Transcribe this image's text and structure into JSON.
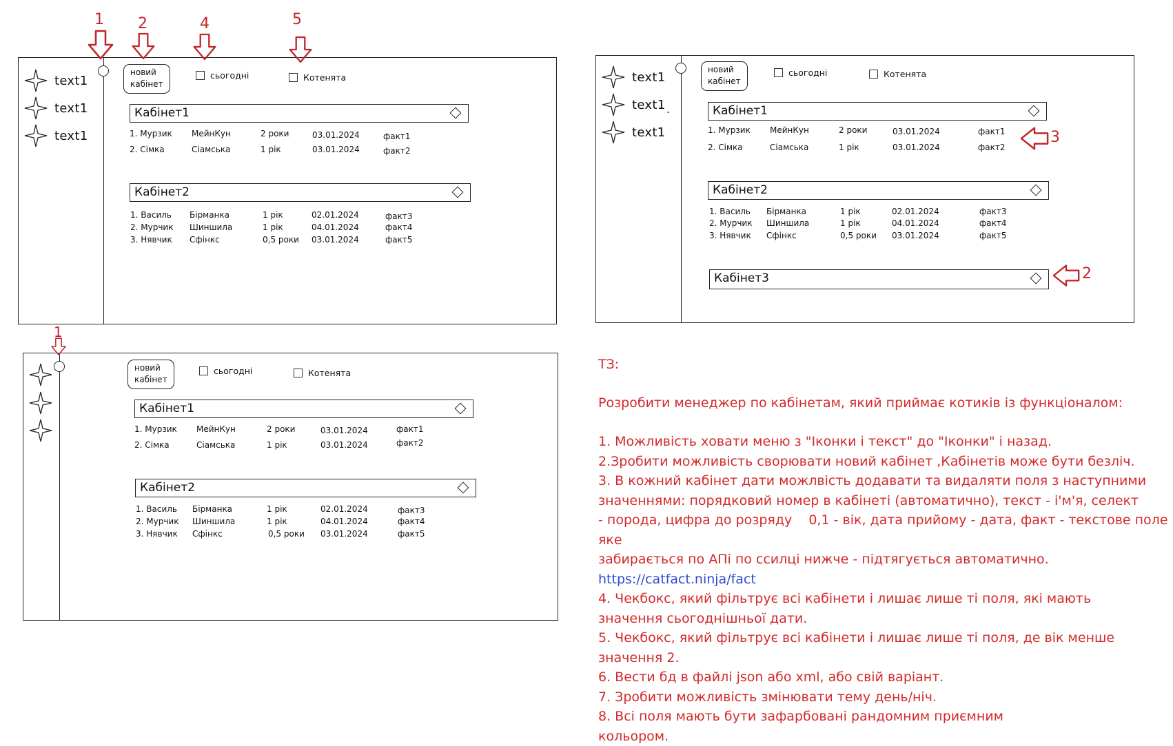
{
  "sidebar": {
    "items": [
      {
        "icon": "star-icon",
        "label": "text1"
      },
      {
        "icon": "star-icon",
        "label": "text1"
      },
      {
        "icon": "star-icon",
        "label": "text1"
      }
    ]
  },
  "toolbar": {
    "new_cabinet_line1": "новий",
    "new_cabinet_line2": "кабінет",
    "today_label": "сьогодні",
    "kittens_label": "Котенята"
  },
  "cabinets": [
    {
      "title": "Кабінет1",
      "rows": [
        [
          "1. Мурзик",
          "МейнКун",
          "2 роки",
          "03.01.2024",
          "факт1"
        ],
        [
          "2. Сімка",
          "Сіамська",
          "1 рік",
          "03.01.2024",
          "факт2"
        ]
      ]
    },
    {
      "title": "Кабінет2",
      "rows": [
        [
          "1. Василь",
          "Бірманка",
          "1 рік",
          "02.01.2024",
          "факт3"
        ],
        [
          "2. Мурчик",
          "Шиншила",
          "1 рік",
          "04.01.2024",
          "факт4"
        ],
        [
          "3. Нявчик",
          "Сфінкс",
          "0,5 роки",
          "03.01.2024",
          "факт5"
        ]
      ]
    },
    {
      "title": "Кабінет3",
      "rows": []
    }
  ],
  "annotations": {
    "n1": "1",
    "n2": "2",
    "n3": "3",
    "n4": "4",
    "n5": "5",
    "side_n3": "3",
    "side_n2": "2",
    "bottom_n1": "1",
    "dot": "."
  },
  "task": {
    "heading": "ТЗ:",
    "intro": "Розробити менеджер по кабінетам, який приймає котиків із функціоналом:",
    "p1": "1. Можливість ховати меню з \"Іконки і текст\" до \"Іконки\" і назад.",
    "p2": "2.Зробити можливість сворювати новий кабінет ,Кабінетів може бути безліч.",
    "p3a": "3. В кожний кабінет дати можлвість додавати та видаляти поля з наступними",
    "p3b": "значеннями: порядковий номер в кабінеті (автоматично), текст - і'м'я, селект",
    "p3c": "- порода, цифра до розряду    0,1 - вік, дата прийому - дата, факт - текстове поле яке",
    "p3d": "забирається по АПі по ссилці нижче - підтягується автоматично.",
    "link": "https://catfact.ninja/fact",
    "p4a": "4. Чекбокс, який фільтрує всі кабінети і лишає лише ті поля, які мають",
    "p4b": "значення сьогоднішньої дати.",
    "p5a": "5. Чекбокс, який фільтрує всі кабінети і лишає лише ті поля, де вік менше",
    "p5b": "значення 2.",
    "p6": "6. Вести бд в файлі json або xml, або свій варіант.",
    "p7": "7. Зробити можливість змінювати тему день/ніч.",
    "p8a": "8. Всі поля мають бути зафарбовані рандомним приємним",
    "p8b": "кольором."
  },
  "colors": {
    "annotation": "#c0272d",
    "link": "#2f4bd0",
    "task_text": "#d32a2a"
  }
}
